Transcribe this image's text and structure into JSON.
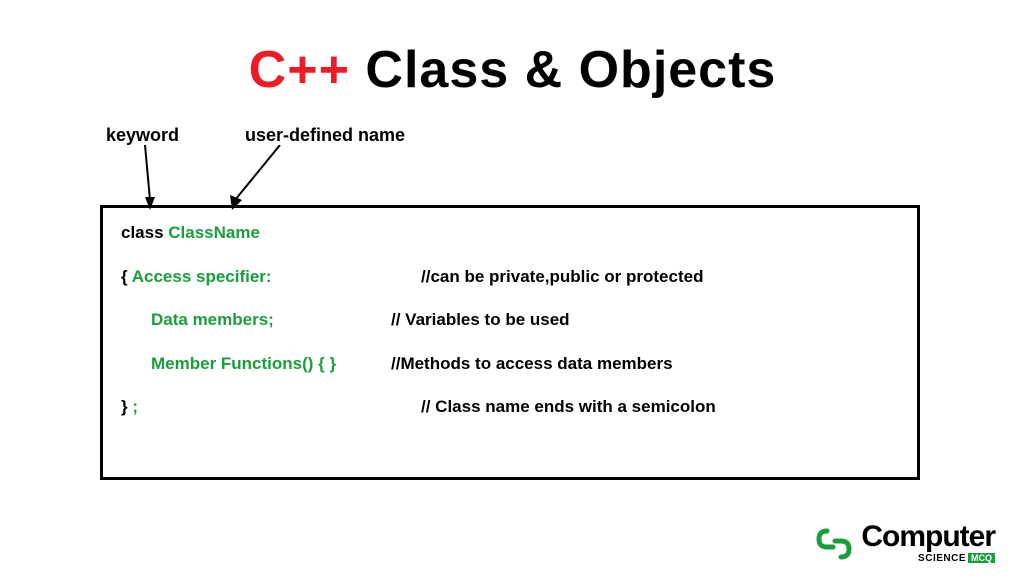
{
  "title": {
    "cpp": "C++",
    "rest": " Class & Objects"
  },
  "labels": {
    "keyword": "keyword",
    "userdefined": "user-defined name"
  },
  "code": {
    "line1_keyword": "class ",
    "line1_classname": "ClassName",
    "line2_brace": "{   ",
    "line2_green": "Access specifier:",
    "line2_comment": "//can be private,public or protected",
    "line3_green": "Data members;",
    "line3_comment": "// Variables to be used",
    "line4_green": "Member Functions() { }",
    "line4_comment": "//Methods to access data members",
    "line5_brace": "} ",
    "line5_semicolon": ";",
    "line5_comment": "// Class name ends with a semicolon"
  },
  "logo": {
    "main": "Computer",
    "sub": "SCIENCE",
    "mcq": "MCQ"
  }
}
